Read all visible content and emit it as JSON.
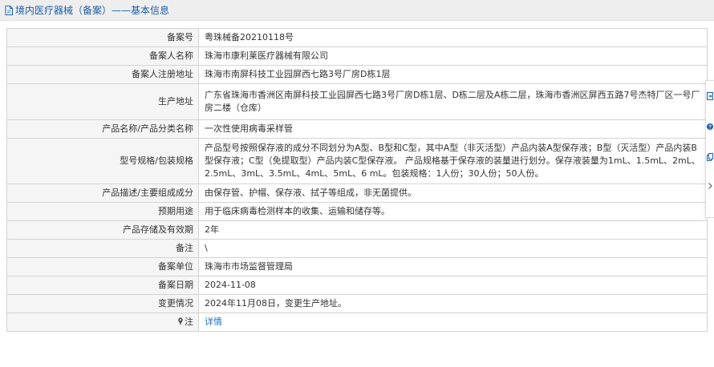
{
  "header": {
    "title": "境内医疗器械（备案）——基本信息",
    "icon": "document-icon"
  },
  "rows": [
    {
      "label": "备案号",
      "value": "粤珠械备20210118号"
    },
    {
      "label": "备案人名称",
      "value": "珠海市康利莱医疗器械有限公司"
    },
    {
      "label": "备案人注册地址",
      "value": "珠海市南屏科技工业园屏西七路3号厂房D栋1层"
    },
    {
      "label": "生产地址",
      "value": "广东省珠海市香洲区南屏科技工业园屏西七路3号厂房D栋1层、D栋二层及A栋二层，珠海市香洲区屏西五路7号杰特厂区一号厂房二楼（仓库）"
    },
    {
      "label": "产品名称/产品分类名称",
      "value": "一次性使用病毒采样管"
    },
    {
      "label": "型号规格/包装规格",
      "value": "产品型号按照保存液的成分不同划分为A型、B型和C型，其中A型（非灭活型）产品内装A型保存液；B型（灭活型）产品内装B型保存液；C型（免提取型）产品内装C型保存液。 产品规格基于保存液的装量进行划分。保存液装量为1mL、1.5mL、2mL、2.5mL、3mL、3.5mL、4mL、5mL、6 mL。包装规格：1人份；30人份；50人份。"
    },
    {
      "label": "产品描述/主要组成成分",
      "value": "由保存管、护帽、保存液、拭子等组成，非无菌提供。"
    },
    {
      "label": "预期用途",
      "value": "用于临床病毒检测样本的收集、运输和储存等。"
    },
    {
      "label": "产品存储及有效期",
      "value": "2年"
    },
    {
      "label": "备注",
      "value": "\\"
    },
    {
      "label": "备案单位",
      "value": "珠海市市场监督管理局"
    },
    {
      "label": "备案日期",
      "value": "2024-11-08"
    },
    {
      "label": "变更情况",
      "value": "2024年11月08日，变更生产地址。"
    }
  ],
  "note_row": {
    "label": "注",
    "link": "详情",
    "icon": "pin-icon"
  },
  "side_tools": [
    "export-icon",
    "help-icon",
    "copy-icon",
    "chevron-right-icon"
  ]
}
